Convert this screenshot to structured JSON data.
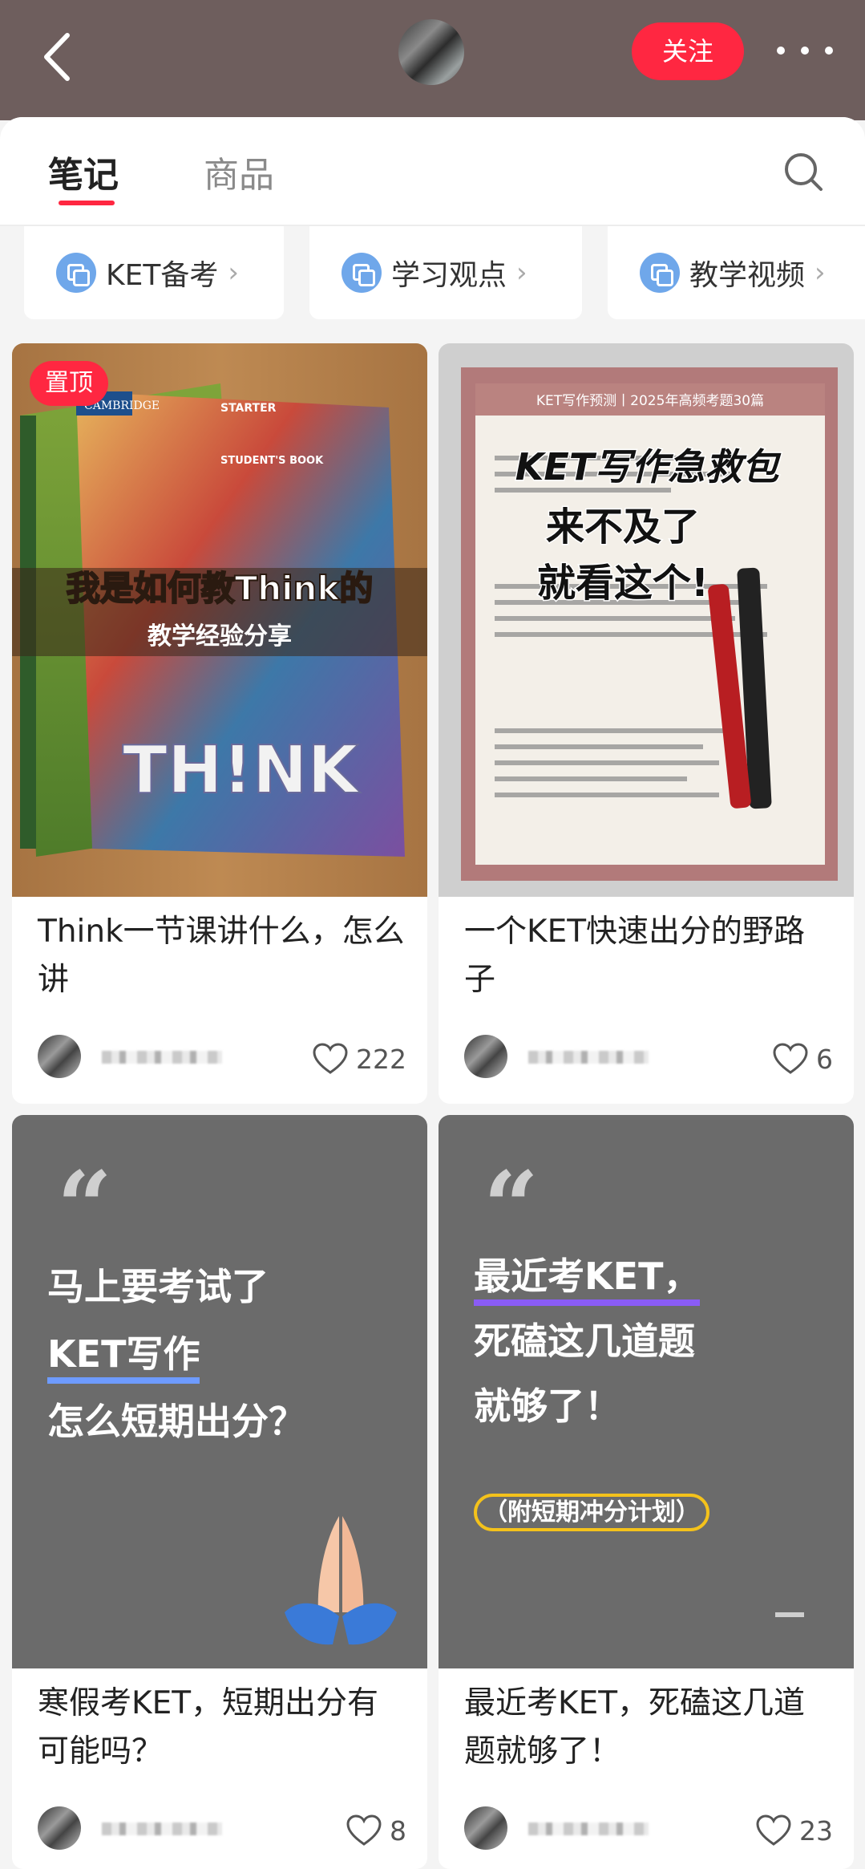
{
  "header": {
    "follow_label": "关注"
  },
  "tabs": [
    {
      "label": "笔记",
      "active": true
    },
    {
      "label": "商品",
      "active": false
    }
  ],
  "collections": [
    {
      "label": "KET备考"
    },
    {
      "label": "学习观点"
    },
    {
      "label": "教学视频"
    }
  ],
  "notes": [
    {
      "badge": "置顶",
      "cover_text": [
        "我是如何教Think的",
        "教学经验分享",
        "TH!NK",
        "CAMBRIDGE",
        "STARTER",
        "STUDENT'S BOOK"
      ],
      "title": "Think一节课讲什么，怎么讲",
      "likes": "222"
    },
    {
      "cover_text": [
        "KET写作急救包",
        "来不及了",
        "就看这个!",
        "KET写作预测丨2025年高频考题30篇"
      ],
      "title": "一个KET快速出分的野路子",
      "likes": "6"
    },
    {
      "cover_text": [
        "马上要考试了",
        "KET写作",
        "怎么短期出分？"
      ],
      "title": "寒假考KET，短期出分有可能吗？",
      "likes": "8"
    },
    {
      "cover_text": [
        "最近考KET，",
        "死磕这几道题",
        "就够了！",
        "（附短期冲分计划）"
      ],
      "title": "最近考KET，死磕这几道题就够了！",
      "likes": "23"
    }
  ],
  "icons": {
    "back": "back-arrow-icon",
    "more": "more-dots-icon",
    "search": "search-icon",
    "collection": "collection-icon",
    "heart": "heart-icon"
  },
  "colors": {
    "accent": "#ff2741",
    "header_bg": "#6e5e5d",
    "quote_card_bg": "#6b6b6b"
  }
}
